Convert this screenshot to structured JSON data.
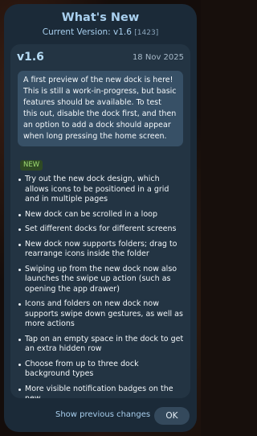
{
  "dialog": {
    "title": "What's New",
    "current_version_label": "Current Version: v1.6",
    "build_number": "[1423]"
  },
  "release": {
    "version": "v1.6",
    "date": "18 Nov 2025",
    "intro": "A first preview of the new dock is here! This is still a work-in-progress, but basic features should be available. To test this out, disable the dock first, and then an option to add a dock should appear when long pressing the home screen.",
    "badge": "NEW",
    "items": [
      "Try out the new dock design, which allows icons to be positioned in a grid and in multiple pages",
      "New dock can be scrolled in a loop",
      "Set different docks for different screens",
      "New dock now supports folders; drag to rearrange icons inside the folder",
      "Swiping up from the new dock now also launches the swipe up action (such as opening the app drawer)",
      "Icons and folders on new dock now supports swipe down gestures, as well as more actions",
      "Tap on an empty space in the dock to get an extra hidden row",
      "Choose from up to three dock background types",
      "More visible notification badges on the new"
    ]
  },
  "footer": {
    "show_previous_label": "Show previous changes",
    "ok_label": "OK"
  },
  "colors": {
    "dialog_bg": "#1b2a38",
    "content_bg": "#233443",
    "intro_bg": "#375066",
    "accent_text": "#a9d0ef",
    "badge_text": "#9fdc73",
    "badge_bg": "#2f4a24"
  }
}
